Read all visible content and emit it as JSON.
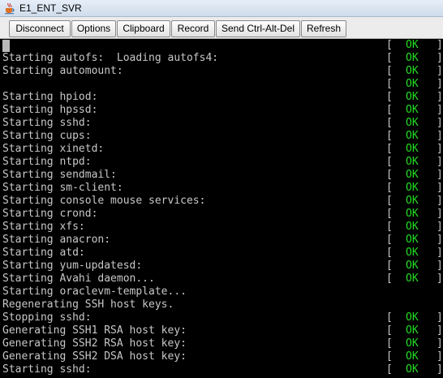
{
  "window": {
    "title": "E1_ENT_SVR",
    "icon": "java-coffee-cup-icon"
  },
  "toolbar": {
    "buttons": [
      {
        "label": "Disconnect"
      },
      {
        "label": "Options"
      },
      {
        "label": "Clipboard"
      },
      {
        "label": "Record"
      },
      {
        "label": "Send Ctrl-Alt-Del"
      },
      {
        "label": "Refresh"
      }
    ]
  },
  "console": {
    "colors": {
      "background": "#000000",
      "text": "#c8c8c8",
      "ok": "#22dd22",
      "cursor": "#b9b9b9"
    },
    "status_brackets": {
      "left": "[",
      "ok": "OK",
      "right": "]"
    },
    "lines": [
      {
        "text": "",
        "status": "OK"
      },
      {
        "text": "Starting autofs:  Loading autofs4:",
        "status": "OK"
      },
      {
        "text": "Starting automount:",
        "status": "OK"
      },
      {
        "text": "",
        "status": "OK"
      },
      {
        "text": "Starting hpiod:",
        "status": "OK"
      },
      {
        "text": "Starting hpssd:",
        "status": "OK"
      },
      {
        "text": "Starting sshd:",
        "status": "OK"
      },
      {
        "text": "Starting cups:",
        "status": "OK"
      },
      {
        "text": "Starting xinetd:",
        "status": "OK"
      },
      {
        "text": "Starting ntpd:",
        "status": "OK"
      },
      {
        "text": "Starting sendmail:",
        "status": "OK"
      },
      {
        "text": "Starting sm-client:",
        "status": "OK"
      },
      {
        "text": "Starting console mouse services:",
        "status": "OK"
      },
      {
        "text": "Starting crond:",
        "status": "OK"
      },
      {
        "text": "Starting xfs:",
        "status": "OK"
      },
      {
        "text": "Starting anacron:",
        "status": "OK"
      },
      {
        "text": "Starting atd:",
        "status": "OK"
      },
      {
        "text": "Starting yum-updatesd:",
        "status": "OK"
      },
      {
        "text": "Starting Avahi daemon...",
        "status": "OK"
      },
      {
        "text": "Starting oraclevm-template...",
        "status": ""
      },
      {
        "text": "Regenerating SSH host keys.",
        "status": ""
      },
      {
        "text": "Stopping sshd:",
        "status": "OK"
      },
      {
        "text": "Generating SSH1 RSA host key:",
        "status": "OK"
      },
      {
        "text": "Generating SSH2 RSA host key:",
        "status": "OK"
      },
      {
        "text": "Generating SSH2 DSA host key:",
        "status": "OK"
      },
      {
        "text": "Starting sshd:",
        "status": "OK"
      }
    ]
  }
}
